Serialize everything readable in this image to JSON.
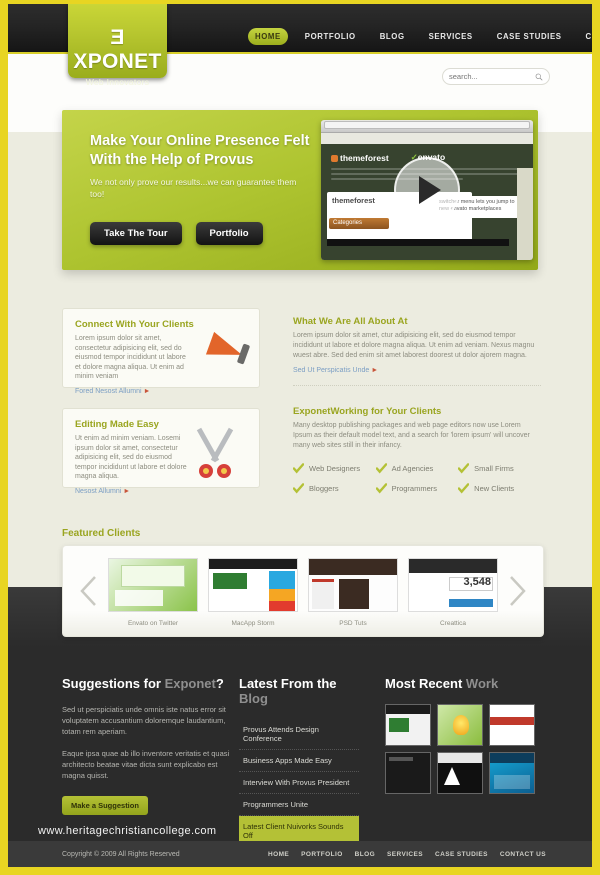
{
  "header": {
    "logo": {
      "prefix": "E",
      "rest": "XPONET",
      "tagline": "Web Innovators"
    },
    "nav": [
      {
        "label": "HOME",
        "active": true
      },
      {
        "label": "PORTFOLIO",
        "active": false
      },
      {
        "label": "BLOG",
        "active": false
      },
      {
        "label": "SERVICES",
        "active": false
      },
      {
        "label": "CASE STUDIES",
        "active": false
      },
      {
        "label": "CONTACT US",
        "active": false
      }
    ],
    "search": {
      "placeholder": "search...",
      "value": ""
    }
  },
  "hero": {
    "title": "Make Your Online Presence Felt With the Help of Provus",
    "subtitle": "We not only prove our results...we can guarantee them too!",
    "button_primary": "Take The Tour",
    "button_secondary": "Portfolio",
    "shot": {
      "logo_themeforest": "themeforest",
      "logo_envato": "envato",
      "logo_envato_sub": "marketplaces",
      "card_caption": "themeforest",
      "category_button": "Categories",
      "tooltip": "switcher menu lets you jump to new envato marketplaces"
    }
  },
  "features": [
    {
      "title": "Connect With Your Clients",
      "body": "Lorem ipsum dolor sit amet, consectetur adipisicing elit, sed do eiusmod tempor incididunt ut labore et dolore magna aliqua. Ut enim ad minim veniam",
      "link": "Fored Nesost Allumni",
      "icon": "megaphone-icon"
    },
    {
      "title": "Editing Made Easy",
      "body": "Ut enim ad minim veniam. Losemi ipsum dolor sit amet, consectetur adipisicing elit, sed do eiusmod tempor incididunt ut labore et dolore magna aliqua.",
      "link": "Nesost Allumni",
      "icon": "scissors-icon"
    }
  ],
  "about": {
    "title": "What We Are All About At",
    "body": "Lorem ipsum dolor sit amet, ctur adipisicing elit, sed do eiusmod tempor incididunt ut labore et dolore magna aliqua. Ut enim ad veniam. Nexus magnu wuest abre. Sed ded enim sit amet laborest doorest ut dolor ajorem magna.",
    "link": "Sed Ut Perspicatis Unde"
  },
  "working": {
    "title": "ExponetWorking for Your Clients",
    "body": "Many desktop publishing packages and web page editors now use Lorem Ipsum as their default model text, and a search for 'lorem ipsum' will uncover many web sites still in their infancy.",
    "items": [
      "Web Designers",
      "Ad Agencies",
      "Small Firms",
      "Bloggers",
      "Programmers",
      "New Clients"
    ]
  },
  "featured_clients": {
    "title": "Featured Clients",
    "prev_label": "previous",
    "next_label": "next",
    "items": [
      {
        "caption": "Envato on Twitter"
      },
      {
        "caption": "MacApp Storm"
      },
      {
        "caption": "PSD Tuts"
      },
      {
        "caption": "Creattica",
        "badge": "3,548"
      }
    ]
  },
  "footer": {
    "suggestions": {
      "title_strong": "Suggestions for ",
      "title_muted": "Exponet",
      "title_end": "?",
      "para1": "Sed ut perspiciatis unde omnis iste natus error sit voluptatem accusantium doloremque laudantium, totam rem aperiam.",
      "para2": "Eaque ipsa quae ab illo inventore veritatis et quasi architecto beatae vitae dicta sunt explicabo est magna quisst.",
      "button": "Make a Suggestion"
    },
    "blog": {
      "title_strong": "Latest From the ",
      "title_muted": "Blog",
      "items": [
        {
          "label": "Provus Attends Design Conference",
          "highlight": false
        },
        {
          "label": "Business Apps Made Easy",
          "highlight": false
        },
        {
          "label": "Interview With Provus President",
          "highlight": false
        },
        {
          "label": "Programmers Unite",
          "highlight": false
        },
        {
          "label": "Latest Client Nuivorks Sounds Off",
          "highlight": true
        }
      ]
    },
    "work": {
      "title_strong": "Most Recent ",
      "title_muted": "Work",
      "items": [
        {
          "name": "macappstorm-thumb"
        },
        {
          "name": "lightbulb-thumb"
        },
        {
          "name": "creattica-thumb"
        },
        {
          "name": "dark-site-thumb"
        },
        {
          "name": "rockable-thumb"
        },
        {
          "name": "fabium-thumb"
        }
      ]
    },
    "copyright": "Copyright © 2009 All Rights Reserved",
    "nav": [
      "HOME",
      "PORTFOLIO",
      "BLOG",
      "SERVICES",
      "CASE STUDIES",
      "CONTACT US"
    ]
  },
  "watermark": "www.heritagechristiancollege.com",
  "colors": {
    "accent": "#b4c136",
    "frame": "#e8d522",
    "dark": "#2b2b2b",
    "link": "#7b9ec4"
  }
}
